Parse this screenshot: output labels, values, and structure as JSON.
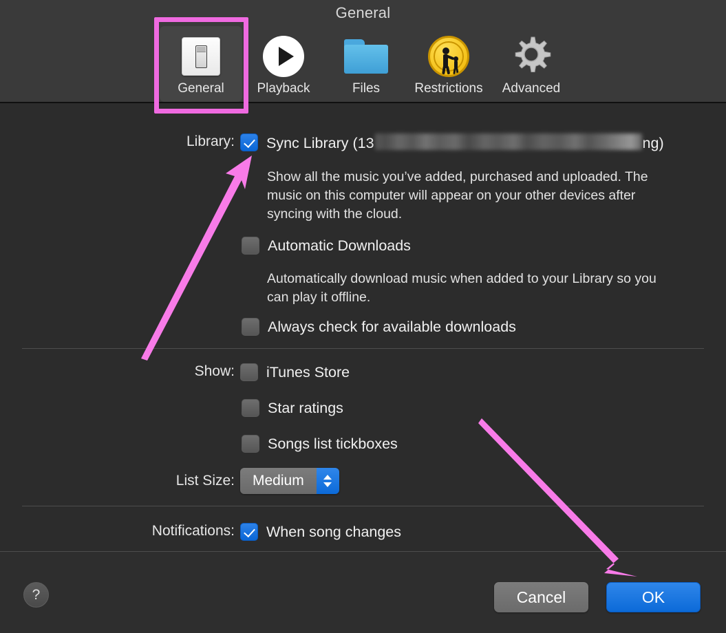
{
  "window": {
    "title": "General"
  },
  "toolbar": {
    "items": [
      {
        "label": "General",
        "icon": "light-switch-icon",
        "selected": true
      },
      {
        "label": "Playback",
        "icon": "play-circle-icon",
        "selected": false
      },
      {
        "label": "Files",
        "icon": "folder-icon",
        "selected": false
      },
      {
        "label": "Restrictions",
        "icon": "parental-controls-icon",
        "selected": false
      },
      {
        "label": "Advanced",
        "icon": "gear-icon",
        "selected": false
      }
    ]
  },
  "library": {
    "label": "Library:",
    "sync": {
      "prefix": "Sync Library (13",
      "suffix": "ng)",
      "redacted": true,
      "checked": true
    },
    "sync_description": "Show all the music you’ve added, purchased and uploaded. The music on this computer will appear on your other devices after syncing with the cloud.",
    "automatic_downloads": {
      "label": "Automatic Downloads",
      "checked": false
    },
    "automatic_downloads_description": "Automatically download music when added to your Library so you can play it offline.",
    "always_check": {
      "label": "Always check for available downloads",
      "checked": false
    }
  },
  "show": {
    "label": "Show:",
    "options": [
      {
        "label": "iTunes Store",
        "checked": false
      },
      {
        "label": "Star ratings",
        "checked": false
      },
      {
        "label": "Songs list tickboxes",
        "checked": false
      }
    ]
  },
  "list_size": {
    "label": "List Size:",
    "value": "Medium"
  },
  "notifications": {
    "label": "Notifications:",
    "option": {
      "label": "When song changes",
      "checked": true
    }
  },
  "footer": {
    "help": "?",
    "cancel": "Cancel",
    "ok": "OK"
  },
  "annotations": {
    "highlight_color": "#ef6ae0",
    "arrow_color": "#f87be8",
    "shapes": [
      {
        "type": "rectangle",
        "target": "toolbar-item-general"
      },
      {
        "type": "arrow",
        "target": "sync-library-checkbox"
      },
      {
        "type": "arrow",
        "target": "ok-button"
      }
    ]
  }
}
